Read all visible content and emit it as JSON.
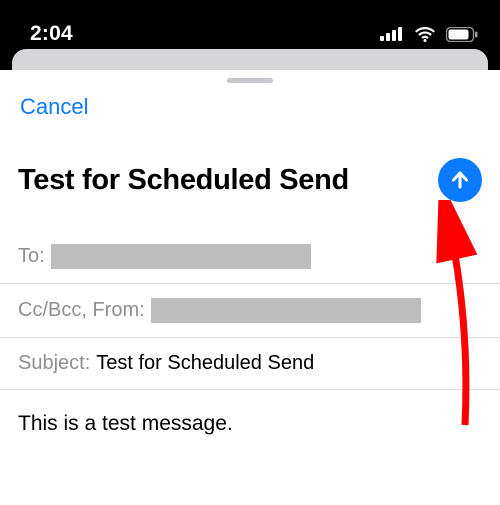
{
  "statusbar": {
    "time": "2:04"
  },
  "compose": {
    "cancel_label": "Cancel",
    "title": "Test for Scheduled Send",
    "to_label": "To:",
    "ccbcc_label": "Cc/Bcc, From:",
    "subject_label": "Subject:",
    "subject_value": "Test for Scheduled Send",
    "body": "This is a test message."
  },
  "colors": {
    "accent": "#0a7aff"
  }
}
